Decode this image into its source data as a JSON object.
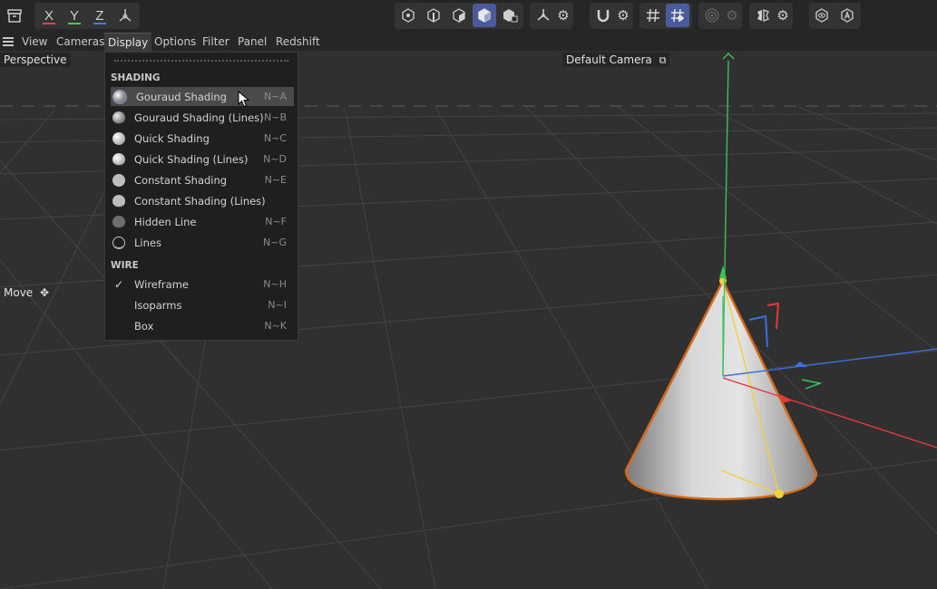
{
  "toolbar": {
    "axes": [
      {
        "label": "X",
        "color": "#e04444"
      },
      {
        "label": "Y",
        "color": "#55c455"
      },
      {
        "label": "Z",
        "color": "#4a7be0"
      }
    ],
    "icons": [
      "archive-icon",
      "coordinate-system-icon",
      "points-mode-icon",
      "edges-mode-icon",
      "polygons-mode-icon",
      "model-mode-icon",
      "texture-mode-icon",
      "axis-mode-icon",
      "settings-icon",
      "snap-icon",
      "grid-snap-icon",
      "workplane-icon",
      "soft-selection-icon",
      "symmetry-icon",
      "view-icon",
      "auto-icon"
    ]
  },
  "menubar": {
    "items": [
      "View",
      "Cameras",
      "Display",
      "Options",
      "Filter",
      "Panel",
      "Redshift"
    ]
  },
  "viewport": {
    "view_name": "Perspective",
    "camera": "Default Camera",
    "tool": "Move"
  },
  "display_menu": {
    "section_shading": "SHADING",
    "section_wire": "WIRE",
    "shading_items": [
      {
        "label": "Gouraud Shading",
        "shortcut": "N~A",
        "icon": "gouraud-shading-icon"
      },
      {
        "label": "Gouraud Shading (Lines)",
        "shortcut": "N~B",
        "icon": "gouraud-lines-icon"
      },
      {
        "label": "Quick Shading",
        "shortcut": "N~C",
        "icon": "quick-shading-icon"
      },
      {
        "label": "Quick Shading (Lines)",
        "shortcut": "N~D",
        "icon": "quick-lines-icon"
      },
      {
        "label": "Constant Shading",
        "shortcut": "N~E",
        "icon": "constant-shading-icon"
      },
      {
        "label": "Constant Shading (Lines)",
        "shortcut": "",
        "icon": "constant-lines-icon"
      },
      {
        "label": "Hidden Line",
        "shortcut": "N~F",
        "icon": "hidden-line-icon"
      },
      {
        "label": "Lines",
        "shortcut": "N~G",
        "icon": "lines-icon"
      }
    ],
    "wire_items": [
      {
        "label": "Wireframe",
        "shortcut": "N~H",
        "checked": true
      },
      {
        "label": "Isoparms",
        "shortcut": "N~I",
        "checked": false
      },
      {
        "label": "Box",
        "shortcut": "N~K",
        "checked": false
      }
    ]
  }
}
